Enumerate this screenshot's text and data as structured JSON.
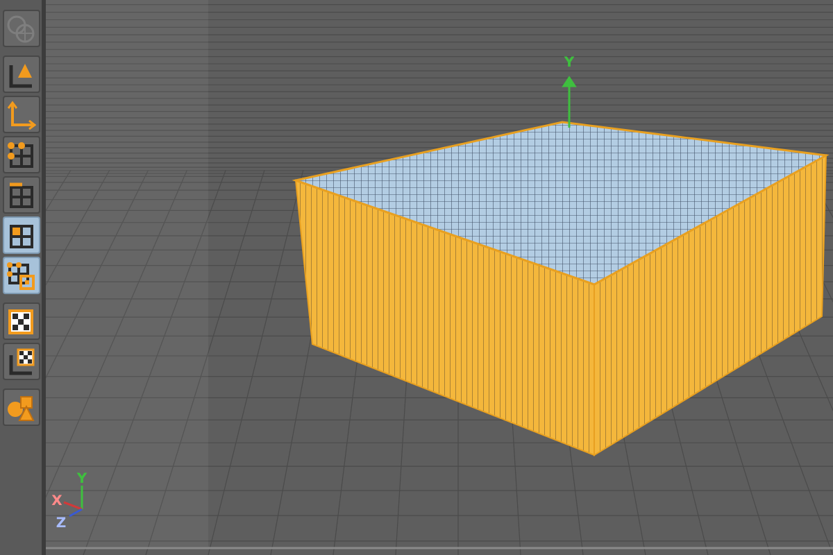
{
  "toolbar": {
    "groups": [
      {
        "buttons": [
          {
            "kind": "view-gizmo",
            "selected": false,
            "disabled": true
          }
        ]
      },
      {
        "buttons": [
          {
            "kind": "axis-cone",
            "selected": false,
            "disabled": false
          },
          {
            "kind": "axis",
            "selected": false,
            "disabled": false
          },
          {
            "kind": "points",
            "selected": false,
            "disabled": false
          },
          {
            "kind": "edges",
            "selected": false,
            "disabled": false
          },
          {
            "kind": "polygons",
            "selected": true,
            "disabled": false
          },
          {
            "kind": "uv-polygons",
            "selected": true,
            "disabled": false
          }
        ]
      },
      {
        "buttons": [
          {
            "kind": "texture",
            "selected": false,
            "disabled": false
          },
          {
            "kind": "texture-axis",
            "selected": false,
            "disabled": false
          }
        ]
      },
      {
        "buttons": [
          {
            "kind": "shapes",
            "selected": false,
            "disabled": false
          }
        ]
      }
    ]
  },
  "viewport": {
    "handle_label": "Y",
    "axis_gizmo": {
      "x": "X",
      "y": "Y",
      "z": "Z"
    }
  }
}
